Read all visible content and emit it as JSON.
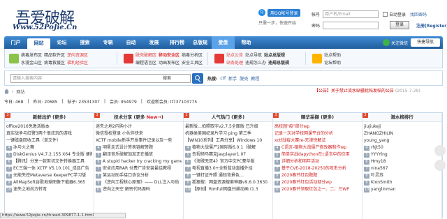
{
  "logo": {
    "cn": "吾爱破解",
    "en": "Www.52PoJie.Cn"
  },
  "login": {
    "qq_button": "用QQ帐号登录",
    "qq_hint": "只需一步，快速开始",
    "username_label": "帐号",
    "username_placeholder": "用户名/Email",
    "remember": "自动登录",
    "forgot": "找回密码",
    "password_label": "密码",
    "login_button": "登录",
    "register": "注册[Register]"
  },
  "nav": {
    "items": [
      "门户",
      "网站",
      "论坛",
      "搜索",
      "专辑",
      "自动",
      "发展",
      "排行榜",
      "总版规",
      "爱盘",
      "帮助"
    ],
    "active_index": 1,
    "highlight_index": 9,
    "follow": "关注微信",
    "quick": "快捷导航"
  },
  "subnav": {
    "groups": [
      {
        "color": "#8bc34a",
        "rows": [
          [
            "病毒发布区",
            "精品软件区",
            "逆向资源区"
          ],
          [
            "水漫金山区",
            "病毒救援区",
            "福利经验区"
          ]
        ]
      },
      {
        "color": "#e53935",
        "rows": [
          [
            "脱壳破解区",
            "移动安全区",
            "病毒分析区"
          ],
          [
            "编程语言区",
            "动画发布区",
            "安全工具区"
          ]
        ]
      },
      {
        "color": "#e53935",
        "rows": [
          [
            "站点公告",
            "站点导航",
            "站点总版规"
          ],
          [
            "站务处理",
            "违规怎么办",
            "违规总版规"
          ]
        ]
      },
      {
        "color": "#ffb300",
        "rows": [
          [
            "站点帮助"
          ],
          [
            "论坛帮助"
          ]
        ]
      }
    ]
  },
  "search": {
    "placeholder": "请输入搜索内容",
    "select": "搜索",
    "hot_label": "热搜:",
    "hot_terms": [
      "ctf",
      "新手",
      "脱壳",
      "教程"
    ]
  },
  "breadcrumb": {
    "items": [
      "网站"
    ]
  },
  "announcement": {
    "text": "【公告】关于禁止流水贴骚扰帖发帖的公告",
    "date": "(2015-7-29)"
  },
  "stats": {
    "items": [
      "今日: 468",
      "|",
      "昨日: 20685",
      "|",
      "帖子: 23531307",
      "|",
      "会员: 954979",
      "|",
      "欢迎新会员: lt737103775"
    ]
  },
  "columns": [
    {
      "title": "新鲜出炉 (更多)",
      "items": [
        {
          "n": "1",
          "t": "office2016免激活版本"
        },
        {
          "n": "2",
          "t": "真实战争与红警3两个很炫玩的游戏"
        },
        {
          "n": "3",
          "t": "一键磁盘回收工具（单文件）"
        },
        {
          "n": "4",
          "t": "冰与火之舞"
        },
        {
          "n": "5",
          "t": "DiskGenius V4.7.2.155 X64 专业版 便携"
        },
        {
          "n": "6",
          "t": "【腾讯】分享一款剪切文件转换器工具"
        },
        {
          "n": "7",
          "t": "EC三端一体 XCTF V5.10.101_成品广告"
        },
        {
          "n": "8",
          "t": "元能失控Metaverse KeeperPC学习版"
        },
        {
          "n": "9",
          "t": "AllMapSoft谷歌地球图像下载器6.365"
        },
        {
          "n": "10",
          "t": "迷失之地尚方转弯"
        }
      ]
    },
    {
      "title": "技术分享 (更多 New→)",
      "items": [
        {
          "n": "1",
          "t": "迷失之地2内购小计"
        },
        {
          "n": "2",
          "t": "微信授权登录 小伙伴快来"
        },
        {
          "n": "3",
          "t": "XCTF mobile新手开发事件记录以及一些"
        },
        {
          "n": "4",
          "t": "明星走式设计答表链解答题"
        },
        {
          "n": "5",
          "t": "翻译音乐破解加加正在播放"
        },
        {
          "n": "6",
          "t": "A stupid hacker try cracking my game"
        },
        {
          "n": "7",
          "t": "安卓应用RAR 付费广告安装最佳教程"
        },
        {
          "n": "8",
          "t": "某运动助手接口协议分析"
        },
        {
          "n": "9",
          "t": "《逆向工程核心原理》—— DLL注入与劫"
        },
        {
          "n": "10",
          "t": "逆向之天空 解密代码源码"
        }
      ]
    },
    {
      "title": "人气热门 (更多)",
      "items": [
        {
          "n": "1",
          "t": "最新版…拍照取字v2.7.5全面版 已升级"
        },
        {
          "n": "2",
          "t": "机器类美国纪录片学习 ping 第三季"
        },
        {
          "n": "3",
          "t": "【WIN10系列】工具分享】Windows 10"
        },
        {
          "n": "4",
          "t": "植物大战僵尸2国际版6.0.1（破解"
        },
        {
          "n": "5",
          "t": "去视频马赛克javplayer1.07"
        },
        {
          "n": "6",
          "t": "《海贼无双4》官方中文PC豪华版"
        },
        {
          "n": "7",
          "t": "电视直播3.0+全新蓝动直播外挂"
        },
        {
          "n": "8",
          "t": "一键打证件照 通知背景色…"
        },
        {
          "n": "9",
          "t": "狐狸搜：网盘资源搜索神器v9.6.0.3630"
        },
        {
          "n": "10",
          "t": "【原创】Rimfull网盘扫描动画 (1.3"
        }
      ]
    },
    {
      "title": "精华采撷 (更多)",
      "items": [
        {
          "n": "1",
          "t": "高校园\"疫\"部分wp"
        },
        {
          "n": "2",
          "t": "记录一次对学校网课平台的分析"
        },
        {
          "n": "3",
          "t": "xctf战疫大赛re-天津快解法"
        },
        {
          "n": "4",
          "t": "C语言-植物大战僵尸修改器制作wp"
        },
        {
          "n": "5",
          "t": "简单实战dapython在c语言中的应用"
        },
        {
          "n": "6",
          "t": "详细分析和明年活动"
        },
        {
          "n": "7",
          "t": "基于CVE-2018-20250的攻击分析"
        },
        {
          "n": "8",
          "t": "2020春节红包题题"
        },
        {
          "n": "9",
          "t": "2020春节红包活动部分wp"
        },
        {
          "n": "10",
          "t": "2020春节领取红包之一、二、三WP"
        }
      ]
    },
    {
      "title": "潜水榜排行",
      "items": [
        {
          "n": "1",
          "t": "jiujiukeji"
        },
        {
          "n": "2",
          "t": "ZHANGZHILIN"
        },
        {
          "n": "3",
          "t": "young_yang"
        },
        {
          "n": "4",
          "t": "rhjt50"
        },
        {
          "n": "5",
          "t": "YYYYing"
        },
        {
          "n": "6",
          "t": "Hmy18"
        },
        {
          "n": "7",
          "t": "nina567"
        },
        {
          "n": "8",
          "t": "叶灵苏"
        },
        {
          "n": "9",
          "t": "KionSmith"
        },
        {
          "n": "10",
          "t": "yanglinman"
        }
      ]
    }
  ],
  "status_bar": "https://www.52pojie.cn/thread-309877-1-1.html"
}
